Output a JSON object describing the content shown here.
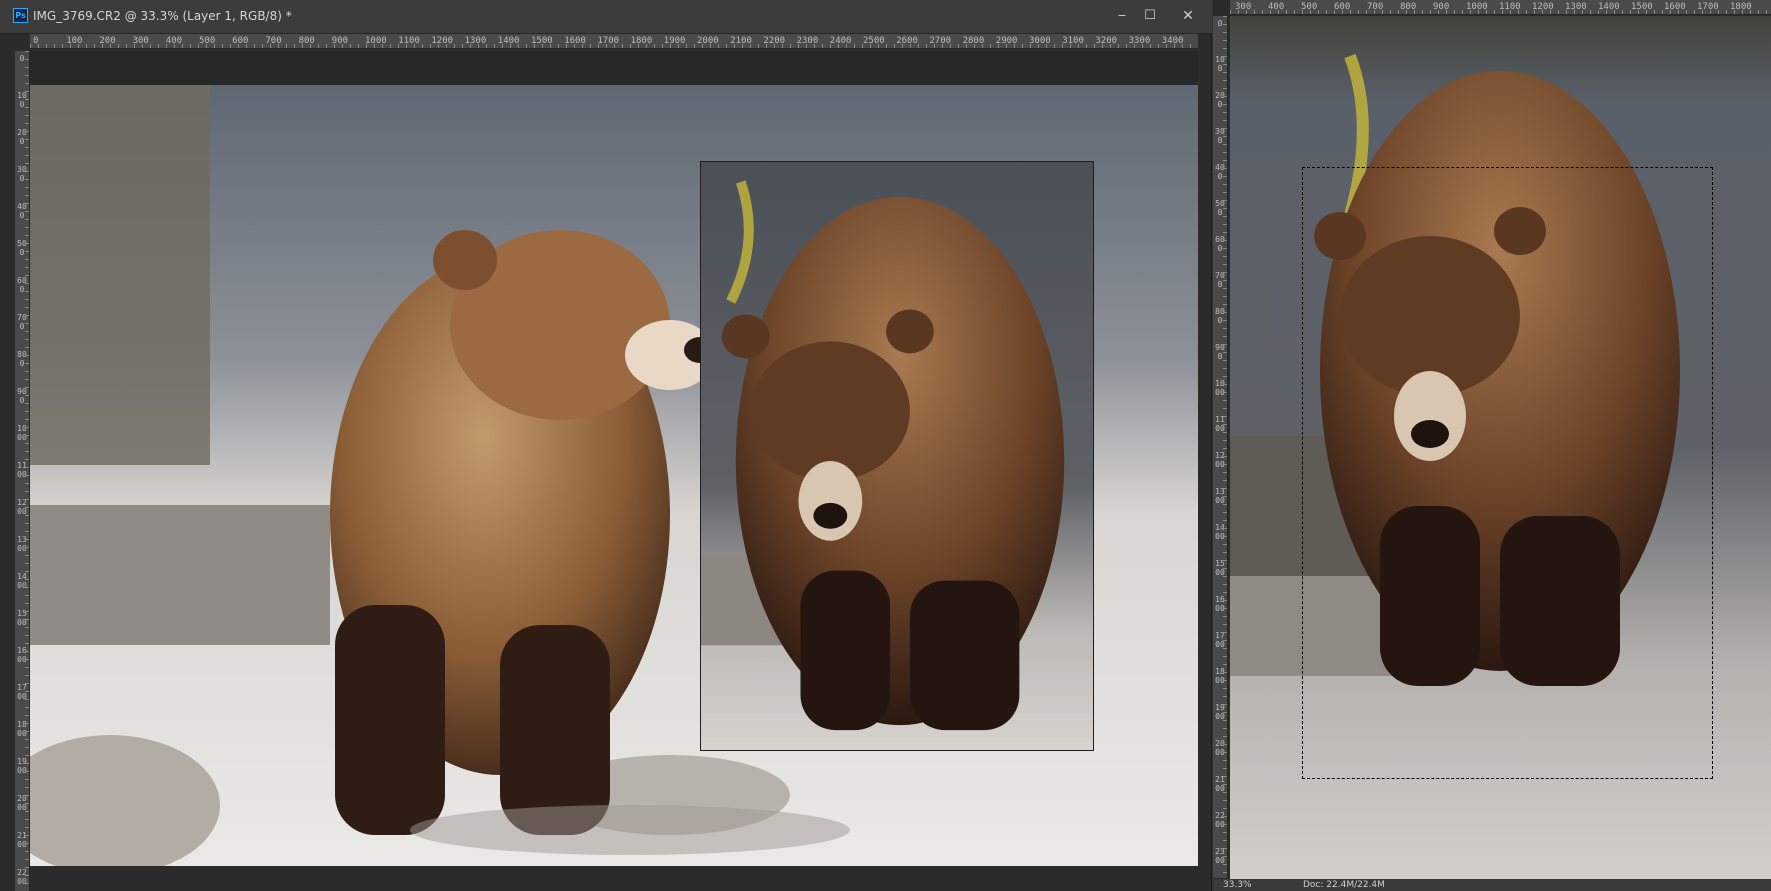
{
  "window": {
    "title": "IMG_3769.CR2 @ 33.3% (Layer 1, RGB/8) *",
    "app_icon": "Ps",
    "minimize_glyph": "‒",
    "maximize_glyph": "☐",
    "close_glyph": "✕"
  },
  "left_ruler_h": [
    "0",
    "100",
    "200",
    "300",
    "400",
    "500",
    "600",
    "700",
    "800",
    "900",
    "1000",
    "1100",
    "1200",
    "1300",
    "1400",
    "1500",
    "1600",
    "1700",
    "1800",
    "1900",
    "2000",
    "2100",
    "2200",
    "2300",
    "2400",
    "2500",
    "2600",
    "2700",
    "2800",
    "2900",
    "3000",
    "3100",
    "3200",
    "3300",
    "3400"
  ],
  "left_ruler_v": [
    "0",
    "100",
    "200",
    "300",
    "400",
    "500",
    "600",
    "700",
    "800",
    "900",
    "1000",
    "1100",
    "1200",
    "1300",
    "1400",
    "1500",
    "1600",
    "1700",
    "1800",
    "1900",
    "2000",
    "2100",
    "2200"
  ],
  "right_ruler_h": [
    "300",
    "400",
    "500",
    "600",
    "700",
    "800",
    "900",
    "1000",
    "1100",
    "1200",
    "1300",
    "1400",
    "1500",
    "1600",
    "1700",
    "1800"
  ],
  "right_ruler_v": [
    "0",
    "100",
    "200",
    "300",
    "400",
    "500",
    "600",
    "700",
    "800",
    "900",
    "1000",
    "1100",
    "1200",
    "1300",
    "1400",
    "1500",
    "1600",
    "1700",
    "1800",
    "1900",
    "2000",
    "2100",
    "2200",
    "2300"
  ],
  "status": {
    "zoom": "33.3%",
    "doc": "Doc: 22.4M/22.4M"
  },
  "colors": {
    "app_bg": "#323232",
    "title_bar": "#3c3c3c",
    "ruler": "#4a4a4a"
  }
}
